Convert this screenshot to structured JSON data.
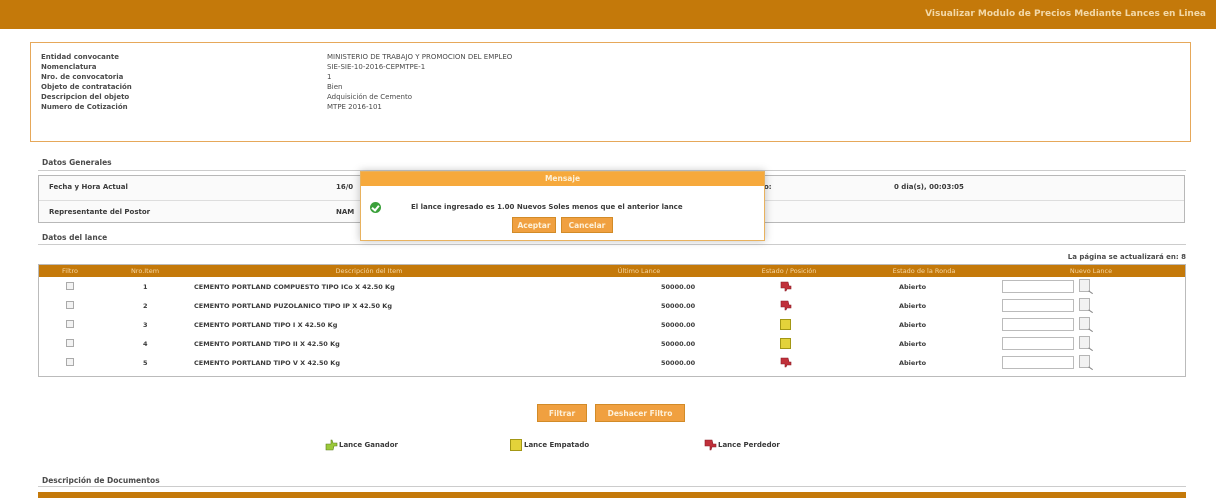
{
  "header": {
    "title": "Visualizar Modulo de Precios Mediante Lances en Linea"
  },
  "info": [
    {
      "label": "Entidad convocante",
      "value": "MINISTERIO DE TRABAJO Y PROMOCION DEL EMPLEO"
    },
    {
      "label": "Nomenclatura",
      "value": "SIE-SIE-10-2016-CEPMTPE-1"
    },
    {
      "label": "Nro. de convocatoria",
      "value": "1"
    },
    {
      "label": "Objeto de contratación",
      "value": "Bien"
    },
    {
      "label": "Descripcion del objeto",
      "value": "Adquisición de Cemento"
    },
    {
      "label": "Numero de Cotización",
      "value": "MTPE 2016-101"
    }
  ],
  "datos_generales": {
    "section_title": "Datos Generales",
    "fecha_label": "Fecha y Hora Actual",
    "fecha_value": "16/0",
    "tiempo_label": "o:",
    "tiempo_value": "0 dia(s), 00:03:05",
    "representante_label": "Representante del Postor",
    "representante_value": "NAM"
  },
  "lance": {
    "section_title": "Datos del lance",
    "refresh_note": "La página se actualizará en: 8",
    "columns": [
      "Filtro",
      "Nro.Item",
      "Descripción del Item",
      "Último Lance",
      "Estado / Posición",
      "Estado de la Ronda",
      "Nuevo Lance"
    ],
    "rows": [
      {
        "num": "1",
        "desc": "CEMENTO PORTLAND COMPUESTO TIPO ICo X 42.50 Kg",
        "last": "50000.00",
        "status": "perdedor",
        "ronda": "Abierto"
      },
      {
        "num": "2",
        "desc": "CEMENTO PORTLAND PUZOLANICO TIPO IP X 42.50 Kg",
        "last": "50000.00",
        "status": "perdedor",
        "ronda": "Abierto"
      },
      {
        "num": "3",
        "desc": "CEMENTO PORTLAND TIPO I X 42.50 Kg",
        "last": "50000.00",
        "status": "empatado",
        "ronda": "Abierto"
      },
      {
        "num": "4",
        "desc": "CEMENTO PORTLAND TIPO II X 42.50 Kg",
        "last": "50000.00",
        "status": "empatado",
        "ronda": "Abierto"
      },
      {
        "num": "5",
        "desc": "CEMENTO PORTLAND TIPO V X 42.50 Kg",
        "last": "50000.00",
        "status": "perdedor",
        "ronda": "Abierto"
      }
    ],
    "filtrar_label": "Filtrar",
    "deshacer_label": "Deshacer Filtro"
  },
  "legend": {
    "ganador": "Lance Ganador",
    "empatado": "Lance Empatado",
    "perdedor": "Lance Perdedor"
  },
  "bottom_section": {
    "title": "Descripción de Documentos"
  },
  "dialog": {
    "title": "Mensaje",
    "message": "El lance ingresado es 1.00 Nuevos Soles menos que el anterior lance",
    "accept_label": "Aceptar",
    "cancel_label": "Cancelar"
  },
  "colors": {
    "primary": "#c4790a",
    "dialog_header": "#f6a93c",
    "button": "#f0a040",
    "perdedor": "#c0303a",
    "empatado": "#e3d23a",
    "ganador": "#7fbf30"
  }
}
